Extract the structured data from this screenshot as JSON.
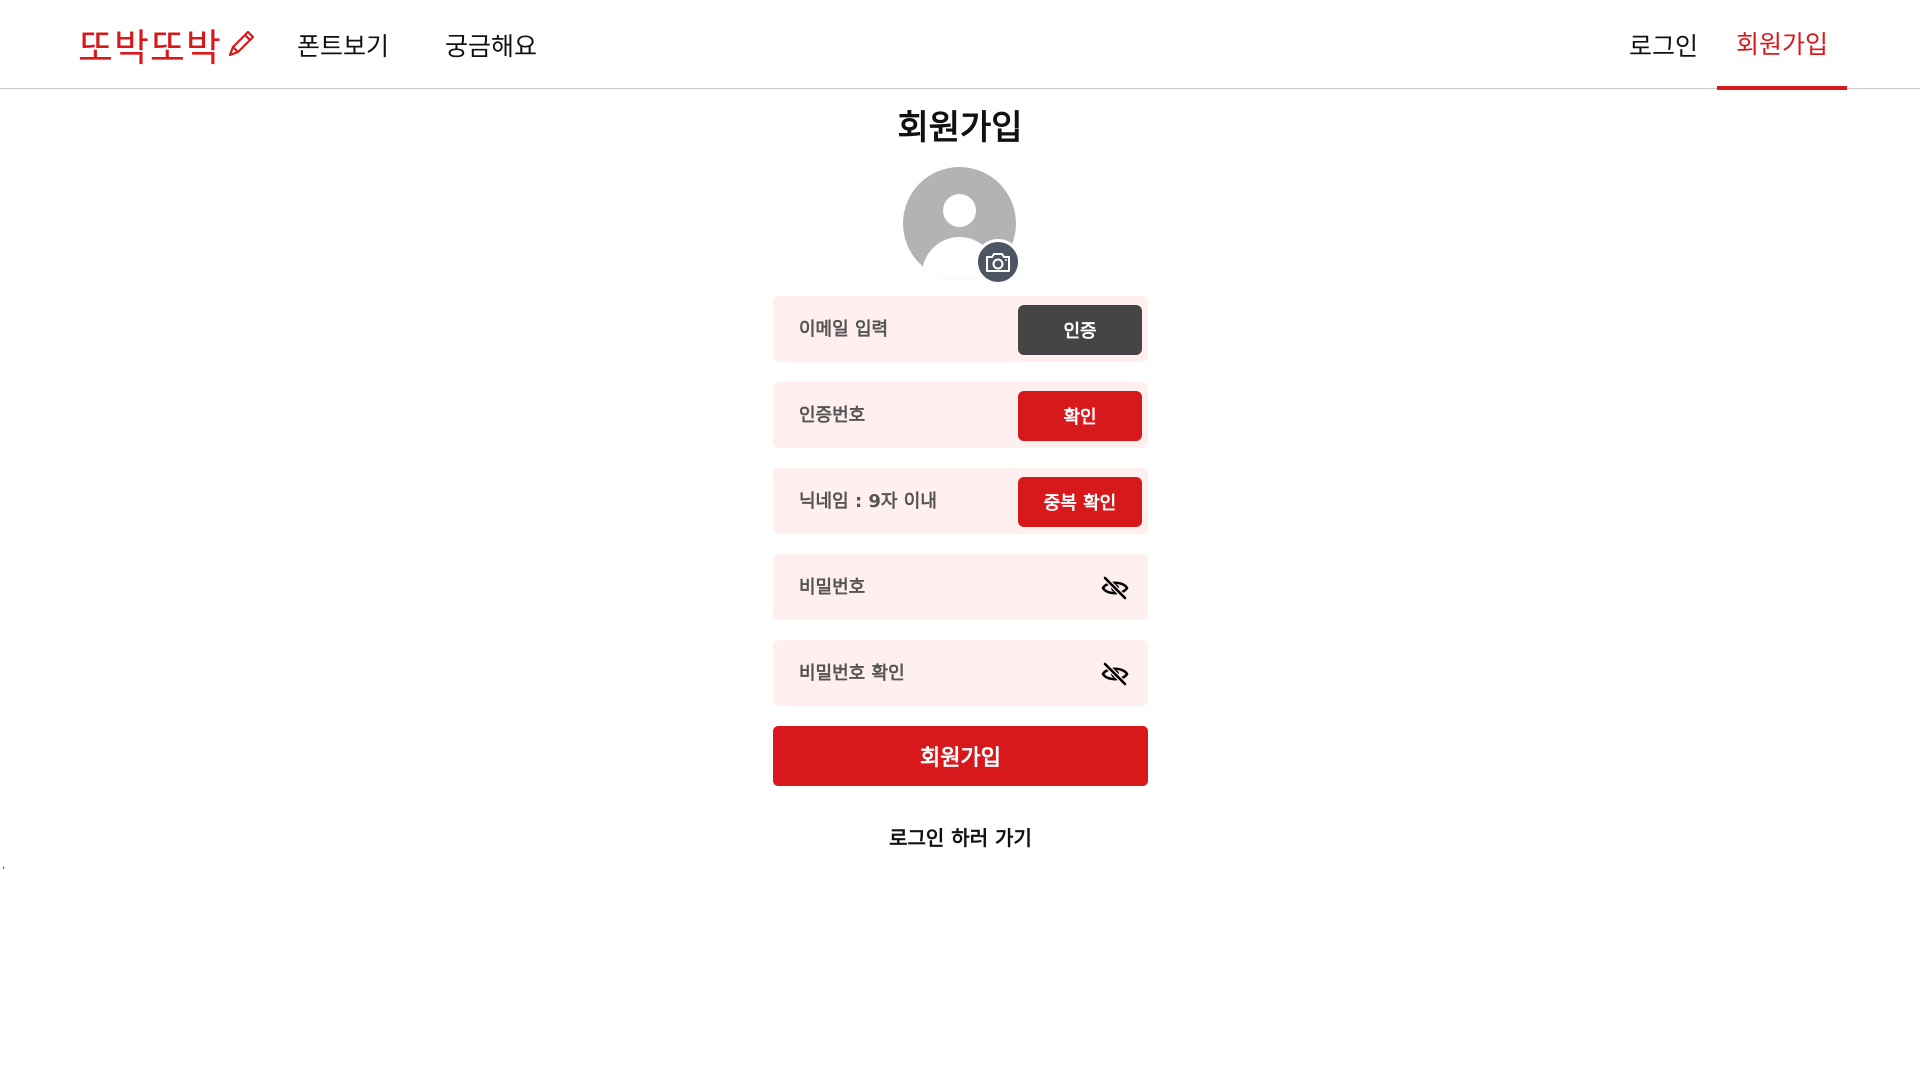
{
  "header": {
    "logo_text": "또박또박",
    "logo_icon": "pencil-icon",
    "nav_left": [
      "폰트보기",
      "궁금해요"
    ],
    "login_label": "로그인",
    "signup_label": "회원가입",
    "accent_color": "#d7191c"
  },
  "main": {
    "title": "회원가입",
    "avatar_icon": "user-avatar-icon",
    "camera_icon": "camera-icon",
    "fields": {
      "email_placeholder": "이메일 입력",
      "email_button": "인증",
      "code_placeholder": "인증번호",
      "code_button": "확인",
      "nickname_placeholder": "닉네임 : 9자 이내",
      "nickname_button": "중복 확인",
      "password_placeholder": "비밀번호",
      "password_confirm_placeholder": "비밀번호 확인",
      "eye_icon": "eye-slash-icon"
    },
    "submit_label": "회원가입",
    "login_link": "로그인 하러 가기",
    "field_bg_color": "#fff0ef",
    "dark_button_color": "#454545"
  },
  "stray_mark": ","
}
